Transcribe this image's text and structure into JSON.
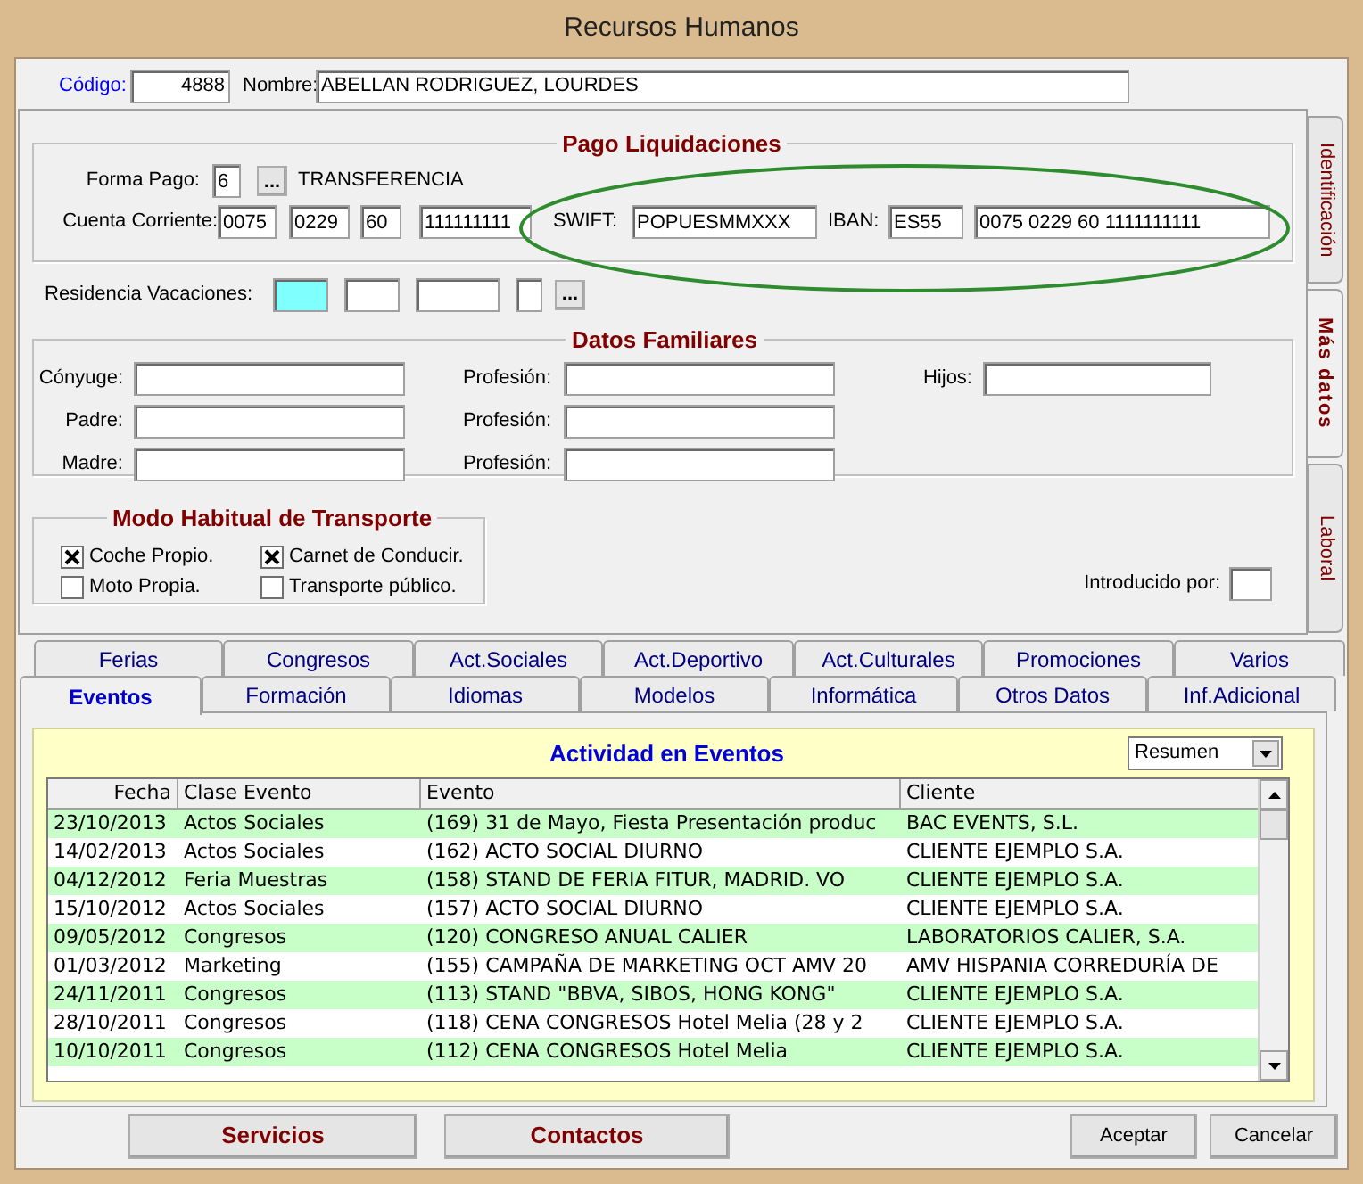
{
  "window": {
    "title": "Recursos Humanos"
  },
  "header": {
    "code_label": "Código:",
    "code": "4888",
    "name_label": "Nombre:",
    "name": "ABELLAN RODRIGUEZ, LOURDES"
  },
  "side_tabs": [
    {
      "label": "Identificación",
      "selected": false
    },
    {
      "label": "Más datos",
      "selected": true
    },
    {
      "label": "Laboral",
      "selected": false
    }
  ],
  "pago": {
    "title": "Pago Liquidaciones",
    "forma_pago_label": "Forma Pago:",
    "forma_pago": "6",
    "browse": "...",
    "forma_pago_name": "TRANSFERENCIA",
    "cuenta_label": "Cuenta Corriente:",
    "cuenta": [
      "0075",
      "0229",
      "60",
      "111111111"
    ],
    "swift_label": "SWIFT:",
    "swift": "POPUESMMXXX",
    "iban_label": "IBAN:",
    "iban_prefix": "ES55",
    "iban": "0075 0229 60 1111111111"
  },
  "residencia": {
    "label": "Residencia Vacaciones:",
    "browse": "..."
  },
  "familia": {
    "title": "Datos Familiares",
    "hijos_label": "Hijos:",
    "rows": [
      {
        "label": "Cónyuge:",
        "profesion_label": "Profesión:"
      },
      {
        "label": "Padre:",
        "profesion_label": "Profesión:"
      },
      {
        "label": "Madre:",
        "profesion_label": "Profesión:"
      }
    ]
  },
  "transporte": {
    "title": "Modo Habitual de Transporte",
    "options": [
      {
        "label": "Coche Propio.",
        "checked": true
      },
      {
        "label": "Carnet de Conducir.",
        "checked": true
      },
      {
        "label": "Moto Propia.",
        "checked": false
      },
      {
        "label": "Transporte público.",
        "checked": false
      }
    ]
  },
  "introducido_label": "Introducido por:",
  "tab_rows": [
    [
      {
        "label": "Ferias",
        "selected": false
      },
      {
        "label": "Congresos",
        "selected": false
      },
      {
        "label": "Act.Sociales",
        "selected": false
      },
      {
        "label": "Act.Deportivo",
        "selected": false
      },
      {
        "label": "Act.Culturales",
        "selected": false
      },
      {
        "label": "Promociones",
        "selected": false
      },
      {
        "label": "Varios",
        "selected": false
      }
    ],
    [
      {
        "label": "Eventos",
        "selected": true
      },
      {
        "label": "Formación",
        "selected": false
      },
      {
        "label": "Idiomas",
        "selected": false
      },
      {
        "label": "Modelos",
        "selected": false
      },
      {
        "label": "Informática",
        "selected": false
      },
      {
        "label": "Otros Datos",
        "selected": false
      },
      {
        "label": "Inf.Adicional",
        "selected": false
      }
    ]
  ],
  "eventos": {
    "title": "Actividad en Eventos",
    "view_select": "Resumen",
    "columns": [
      "Fecha",
      "Clase Evento",
      "Evento",
      "Cliente"
    ],
    "rows": [
      [
        "23/10/2013",
        "Actos Sociales",
        "(169) 31 de Mayo, Fiesta Presentación produc",
        "BAC EVENTS, S.L."
      ],
      [
        "14/02/2013",
        "Actos Sociales",
        "(162) ACTO SOCIAL DIURNO",
        "CLIENTE EJEMPLO S.A."
      ],
      [
        "04/12/2012",
        "Feria Muestras",
        "(158) STAND DE FERIA FITUR, MADRID. VO",
        "CLIENTE EJEMPLO S.A."
      ],
      [
        "15/10/2012",
        "Actos Sociales",
        "(157) ACTO SOCIAL DIURNO",
        "CLIENTE EJEMPLO S.A."
      ],
      [
        "09/05/2012",
        "Congresos",
        "(120) CONGRESO ANUAL CALIER",
        "LABORATORIOS CALIER, S.A."
      ],
      [
        "01/03/2012",
        "Marketing",
        "(155) CAMPAÑA DE MARKETING OCT AMV 20",
        "AMV HISPANIA CORREDURÍA DE"
      ],
      [
        "24/11/2011",
        "Congresos",
        "(113) STAND \"BBVA, SIBOS, HONG KONG\"",
        "CLIENTE EJEMPLO S.A."
      ],
      [
        "28/10/2011",
        "Congresos",
        "(118) CENA CONGRESOS Hotel Melia (28 y 2",
        "CLIENTE EJEMPLO S.A."
      ],
      [
        "10/10/2011",
        "Congresos",
        "(112) CENA CONGRESOS Hotel Melia",
        "CLIENTE EJEMPLO S.A."
      ]
    ]
  },
  "buttons": {
    "left": [
      "Servicios",
      "Contactos"
    ],
    "right": [
      "Aceptar",
      "Cancelar"
    ]
  }
}
